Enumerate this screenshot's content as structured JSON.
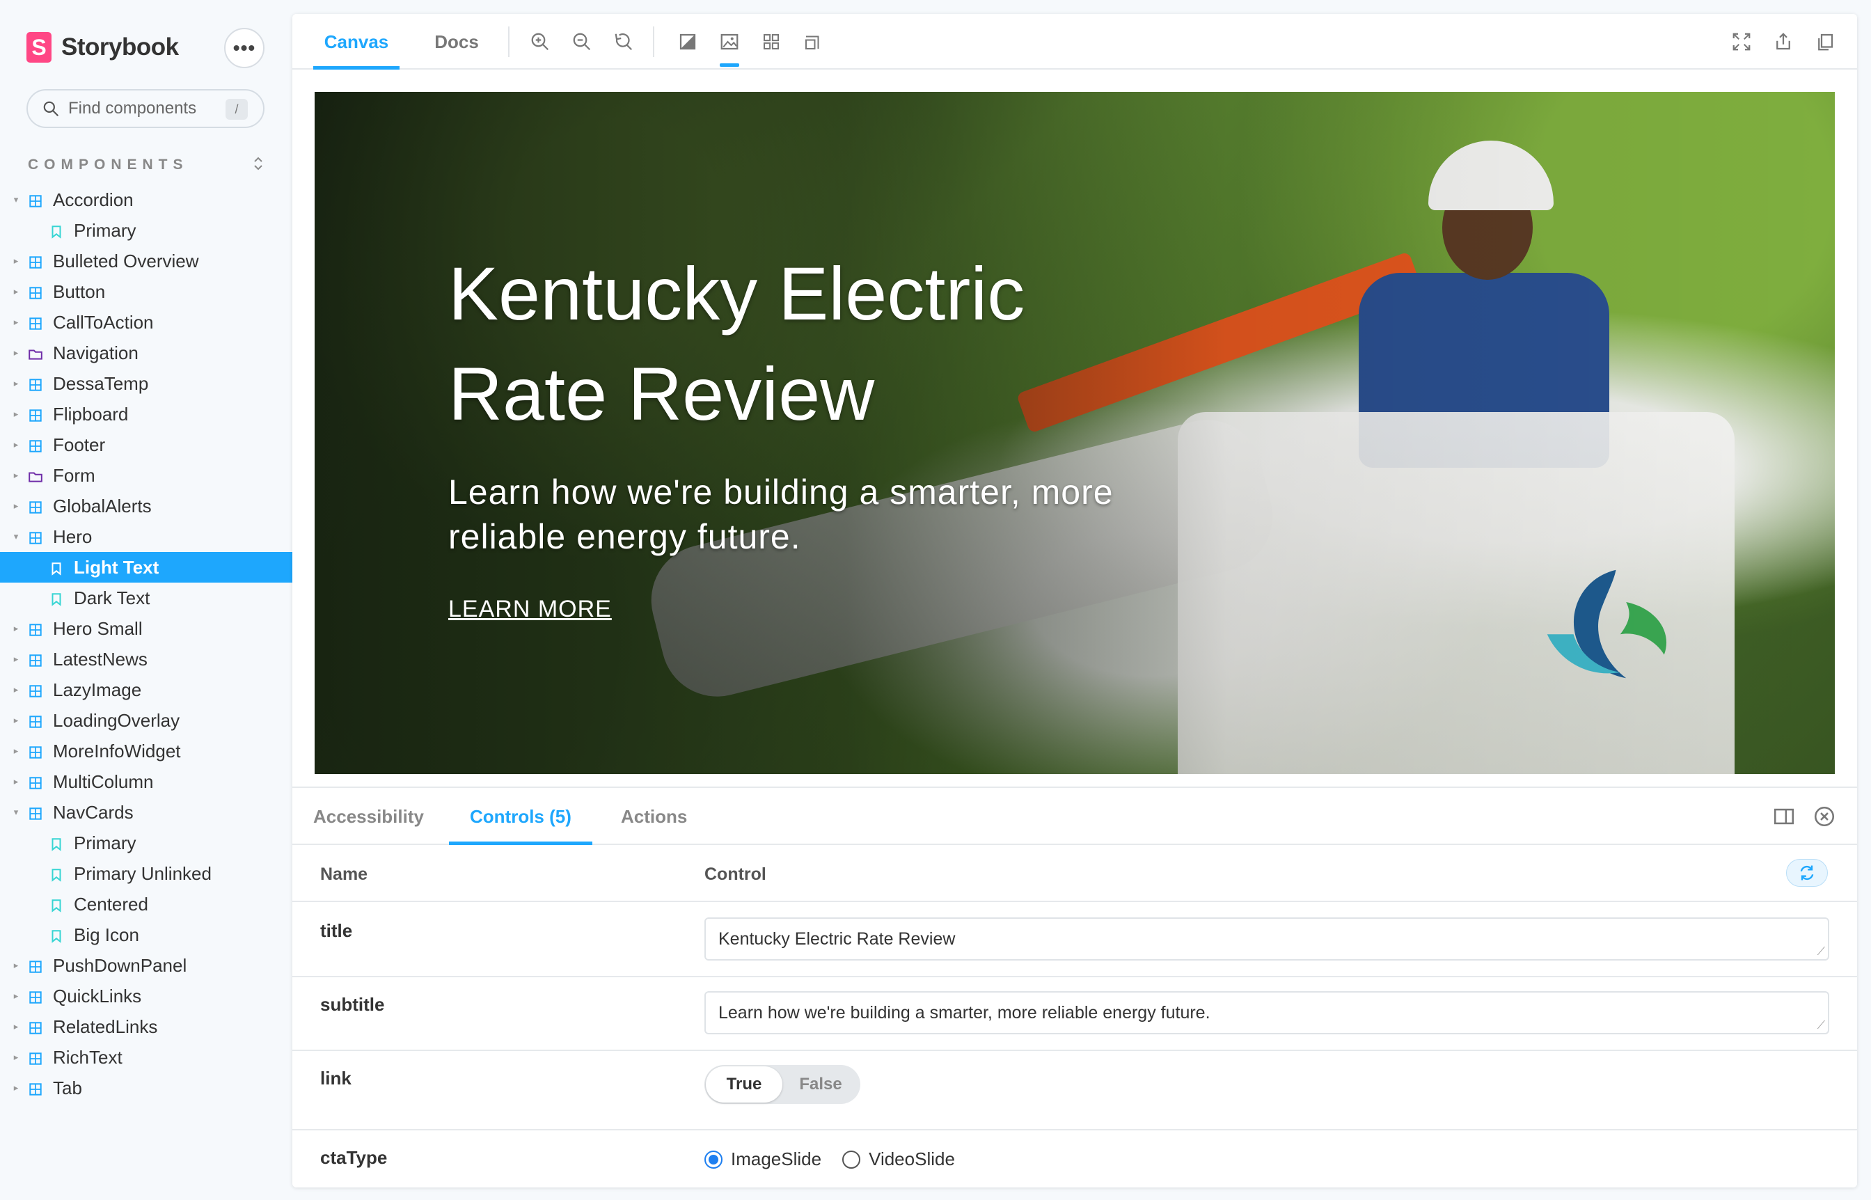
{
  "app": {
    "brand_mark": "S",
    "brand_name": "Storybook",
    "menu_label": "•••",
    "search_placeholder": "Find components",
    "search_shortcut": "/",
    "section_label": "COMPONENTS",
    "section_toggle": "⌃⌄"
  },
  "sidebar": {
    "items": [
      {
        "label": "Accordion",
        "type": "component",
        "expanded": true
      },
      {
        "label": "Primary",
        "type": "story"
      },
      {
        "label": "Bulleted Overview",
        "type": "component"
      },
      {
        "label": "Button",
        "type": "component"
      },
      {
        "label": "CallToAction",
        "type": "component"
      },
      {
        "label": "Navigation",
        "type": "folder"
      },
      {
        "label": "DessaTemp",
        "type": "component"
      },
      {
        "label": "Flipboard",
        "type": "component"
      },
      {
        "label": "Footer",
        "type": "component"
      },
      {
        "label": "Form",
        "type": "folder"
      },
      {
        "label": "GlobalAlerts",
        "type": "component"
      },
      {
        "label": "Hero",
        "type": "component",
        "expanded": true
      },
      {
        "label": "Light Text",
        "type": "story",
        "active": true
      },
      {
        "label": "Dark Text",
        "type": "story"
      },
      {
        "label": "Hero Small",
        "type": "component"
      },
      {
        "label": "LatestNews",
        "type": "component"
      },
      {
        "label": "LazyImage",
        "type": "component"
      },
      {
        "label": "LoadingOverlay",
        "type": "component"
      },
      {
        "label": "MoreInfoWidget",
        "type": "component"
      },
      {
        "label": "MultiColumn",
        "type": "component"
      },
      {
        "label": "NavCards",
        "type": "component",
        "expanded": true
      },
      {
        "label": "Primary",
        "type": "story"
      },
      {
        "label": "Primary Unlinked",
        "type": "story"
      },
      {
        "label": "Centered",
        "type": "story"
      },
      {
        "label": "Big Icon",
        "type": "story"
      },
      {
        "label": "PushDownPanel",
        "type": "component"
      },
      {
        "label": "QuickLinks",
        "type": "component"
      },
      {
        "label": "RelatedLinks",
        "type": "component"
      },
      {
        "label": "RichText",
        "type": "component"
      },
      {
        "label": "Tab",
        "type": "component"
      }
    ]
  },
  "toolbar": {
    "tabs": [
      "Canvas",
      "Docs"
    ],
    "active_tab": "Canvas",
    "icons": [
      "zoom-in-icon",
      "zoom-out-icon",
      "zoom-reset-icon",
      "background-icon",
      "image-icon",
      "grid-icon",
      "outline-icon",
      "fullscreen-icon",
      "share-icon",
      "copy-link-icon"
    ]
  },
  "hero": {
    "title": "Kentucky Electric Rate Review",
    "title_line1": "Kentucky Electric",
    "title_line2": "Rate Review",
    "subtitle_line1": "Learn how we're building a smarter, more",
    "subtitle_line2": "reliable energy future.",
    "cta": "LEARN MORE"
  },
  "addons": {
    "tabs": [
      "Accessibility",
      "Controls (5)",
      "Actions"
    ],
    "active_tab": "Controls (5)",
    "col_name": "Name",
    "col_control": "Control",
    "rows": {
      "title": {
        "name": "title",
        "value": "Kentucky Electric Rate Review"
      },
      "subtitle": {
        "name": "subtitle",
        "value": "Learn how we're building a smarter, more reliable energy future."
      },
      "link": {
        "name": "link",
        "true_label": "True",
        "false_label": "False",
        "value": true
      },
      "ctaType": {
        "name": "ctaType",
        "options": [
          "ImageSlide",
          "VideoSlide"
        ],
        "selected": "ImageSlide"
      }
    }
  },
  "colors": {
    "accent": "#1ea7fd",
    "brand": "#ff4785",
    "radio_selected": "#1e7ff0"
  }
}
